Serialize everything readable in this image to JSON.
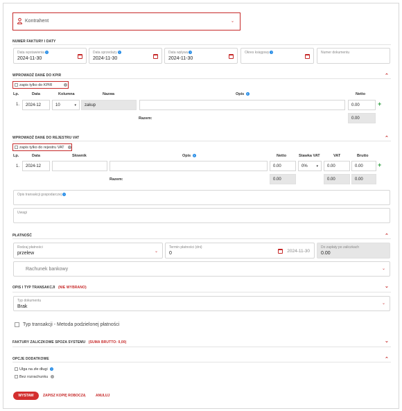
{
  "kontrahent": {
    "placeholder": "Kontrahent"
  },
  "invoice_section": {
    "title": "NUMER FAKTURY I DATY",
    "fields": [
      {
        "label": "Data wystawienia",
        "value": "2024-11-30"
      },
      {
        "label": "Data sprzedaży",
        "value": "2024-11-30"
      },
      {
        "label": "Data wpływu",
        "value": "2024-11-30"
      },
      {
        "label": "Okres księgowy",
        "value": ""
      },
      {
        "label": "Numer dokumentu",
        "value": ""
      }
    ]
  },
  "kpir": {
    "title": "WPROWADŹ DANE DO KPIR",
    "only_label": "zapis tylko do KPiR",
    "headers": {
      "lp": "Lp.",
      "data": "Data",
      "kolumna": "Kolumna",
      "nazwa": "Nazwa",
      "opis": "Opis",
      "netto": "Netto"
    },
    "row": {
      "lp": "1.",
      "data": "2024-12",
      "kolumna": "10",
      "nazwa": "zakup",
      "opis": "",
      "netto": "0.00"
    },
    "sum_label": "Razem:",
    "sum_netto": "0.00"
  },
  "vat": {
    "title": "WPROWADŹ DANE DO REJESTRU VAT",
    "only_label": "zapis tylko do rejestru VAT",
    "headers": {
      "lp": "Lp.",
      "data": "Data",
      "slownik": "Słownik",
      "opis": "Opis",
      "netto": "Netto",
      "stawka": "Stawka VAT",
      "vat": "VAT",
      "brutto": "Brutto"
    },
    "row": {
      "lp": "1.",
      "data": "2024-12",
      "slownik": "",
      "opis": "",
      "netto": "0.00",
      "stawka": "0%",
      "vat": "0.00",
      "brutto": "0.00"
    },
    "sum_label": "Razem:",
    "sum_netto": "0.00",
    "sum_vat": "0.00",
    "sum_brutto": "0.00"
  },
  "transaction_desc": {
    "label": "Opis transakcji gospodarczej"
  },
  "uwagi": {
    "label": "Uwagi"
  },
  "payment": {
    "title": "PŁATNOŚĆ",
    "method_label": "Rodzaj płatności",
    "method_value": "przelew",
    "term_label": "Termin płatności (dni)",
    "term_value": "0",
    "due_date": "2024-11-30",
    "advance_label": "Do zapłaty po zaliczkach",
    "advance_value": "0.00",
    "bank_label": "Rachunek bankowy"
  },
  "transaction_type": {
    "title": "OPIS I TYP TRANSAKCJI",
    "status": "(NIE WYBRANO)",
    "doc_type_label": "Typ dokumentu",
    "doc_type_value": "Brak",
    "split_label": "Typ transakcji - Metoda podzielonej płatności"
  },
  "advance_invoices": {
    "title": "FAKTURY ZALICZKOWE SPOZA SYSTEMU",
    "sum": "(SUMA BRUTTO: 0,00)"
  },
  "extra_options": {
    "title": "OPCJE DODATKOWE",
    "ulga_label": "Ulga na złe długi",
    "bez_label": "Bez rozrachunku"
  },
  "actions": {
    "submit": "WYSTAW",
    "draft": "ZAPISZ KOPIĘ ROBOCZĄ",
    "cancel": "ANULUJ"
  },
  "icons": [
    "user-icon",
    "calendar-icon",
    "help-icon",
    "plus-icon",
    "chevron-down-icon",
    "chevron-up-icon"
  ],
  "colors": {
    "accent": "#c62828",
    "help": "#1e88e5",
    "add": "#2e9e3e"
  }
}
